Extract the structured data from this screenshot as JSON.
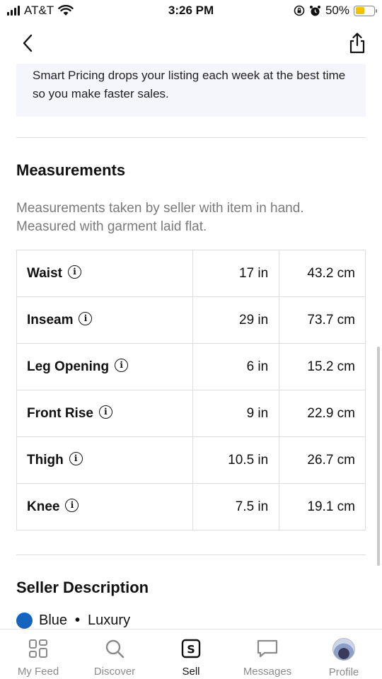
{
  "status_bar": {
    "carrier": "AT&T",
    "time": "3:26 PM",
    "battery": "50%",
    "battery_level": 0.5
  },
  "promo": {
    "text": "Smart Pricing drops your listing each week at the best time so you make faster sales."
  },
  "measurements": {
    "title": "Measurements",
    "subtitle": "Measurements taken by seller with item in hand. Measured with garment laid flat.",
    "rows": [
      {
        "name": "Waist",
        "inches": "17 in",
        "cm": "43.2 cm"
      },
      {
        "name": "Inseam",
        "inches": "29 in",
        "cm": "73.7 cm"
      },
      {
        "name": "Leg Opening",
        "inches": "6 in",
        "cm": "15.2 cm"
      },
      {
        "name": "Front Rise",
        "inches": "9 in",
        "cm": "22.9 cm"
      },
      {
        "name": "Thigh",
        "inches": "10.5 in",
        "cm": "26.7 cm"
      },
      {
        "name": "Knee",
        "inches": "7.5 in",
        "cm": "19.1 cm"
      }
    ]
  },
  "seller_description": {
    "title": "Seller Description",
    "color_name": "Blue",
    "color_hex": "#1565c0",
    "separator": "•",
    "tag": "Luxury"
  },
  "tab_bar": {
    "tabs": [
      {
        "label": "My Feed",
        "icon": "grid-icon"
      },
      {
        "label": "Discover",
        "icon": "search-icon"
      },
      {
        "label": "Sell",
        "icon": "sell-icon",
        "active": true
      },
      {
        "label": "Messages",
        "icon": "chat-bubble-icon"
      },
      {
        "label": "Profile",
        "icon": "avatar"
      }
    ]
  },
  "icons": {
    "back": "chevron-left-icon",
    "share": "share-icon",
    "info": "info-icon",
    "info_glyph": "i"
  }
}
